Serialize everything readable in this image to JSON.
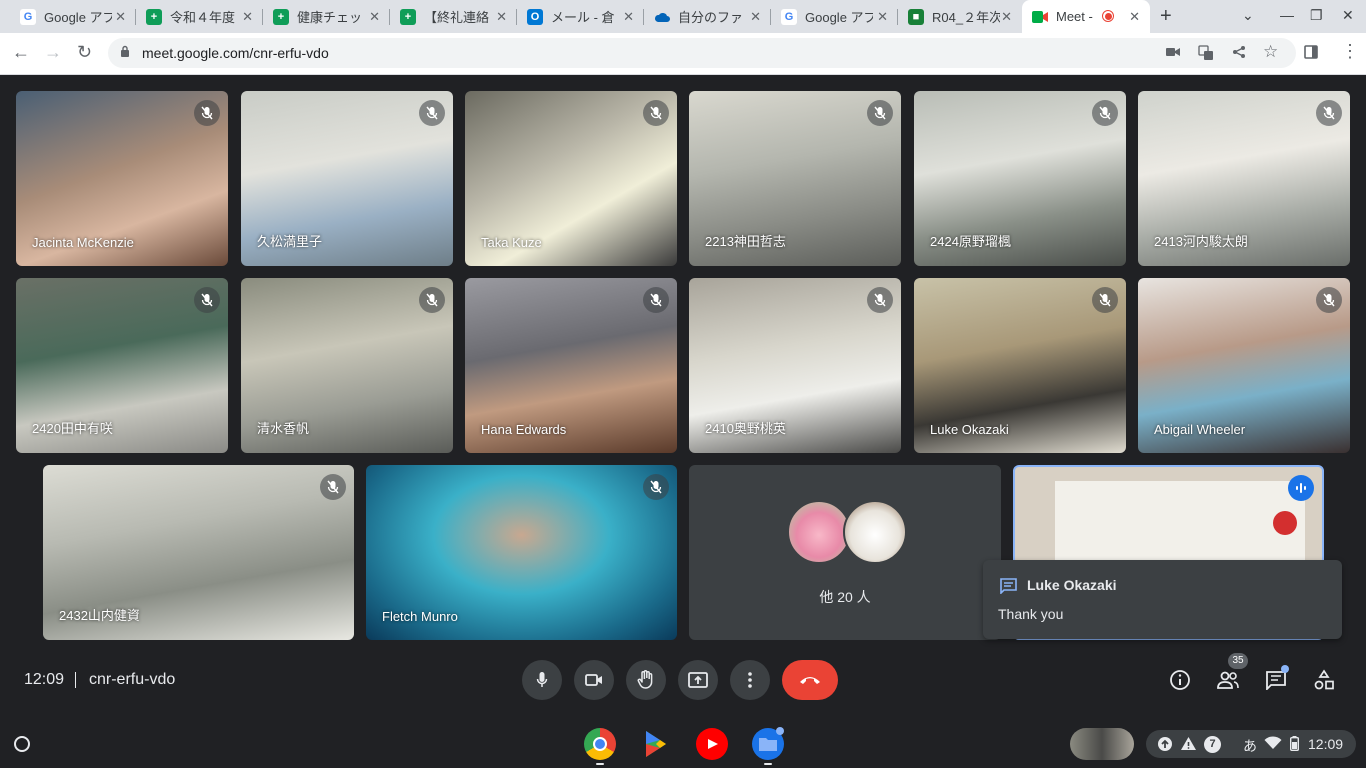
{
  "browser": {
    "tabs": [
      {
        "title": "Google アプ",
        "icon": "google-icon",
        "color": "#4285f4"
      },
      {
        "title": "令和４年度",
        "icon": "sheets-icon",
        "color": "#0f9d58"
      },
      {
        "title": "健康チェッ",
        "icon": "sheets-icon",
        "color": "#0f9d58"
      },
      {
        "title": "【終礼連絡",
        "icon": "sheets-icon",
        "color": "#0f9d58"
      },
      {
        "title": "メール - 倉",
        "icon": "outlook-icon",
        "color": "#0078d4"
      },
      {
        "title": "自分のファ",
        "icon": "onedrive-icon",
        "color": "#0364b8"
      },
      {
        "title": "Google アプ",
        "icon": "google-icon",
        "color": "#4285f4"
      },
      {
        "title": "R04_２年次",
        "icon": "classroom-icon",
        "color": "#188038"
      },
      {
        "title": "Meet -",
        "icon": "meet-icon",
        "color": "#00ac47",
        "active": true
      }
    ],
    "url": "meet.google.com/cnr-erfu-vdo"
  },
  "meeting": {
    "participants": [
      {
        "name": "Jacinta McKenzie"
      },
      {
        "name": "久松満里子"
      },
      {
        "name": "Taka Kuze"
      },
      {
        "name": "2213神田哲志"
      },
      {
        "name": "2424原野瑠楓"
      },
      {
        "name": "2413河内駿太朗"
      },
      {
        "name": "2420田中有咲"
      },
      {
        "name": "清水香帆"
      },
      {
        "name": "Hana Edwards"
      },
      {
        "name": "2410奥野桃英"
      },
      {
        "name": "Luke Okazaki"
      },
      {
        "name": "Abigail Wheeler"
      },
      {
        "name": "2432山内健資"
      },
      {
        "name": "Fletch Munro"
      }
    ],
    "others_label": "他 20 人",
    "chat_popup": {
      "sender": "Luke Okazaki",
      "message": "Thank you"
    },
    "time": "12:09",
    "code": "cnr-erfu-vdo",
    "participant_count": "35"
  },
  "shelf": {
    "notification_count": "7",
    "ime": "あ",
    "time": "12:09"
  },
  "colors": {
    "background": "#202124",
    "surface": "#3c4043",
    "end_call": "#ea4335",
    "accent": "#8ab4f8"
  }
}
